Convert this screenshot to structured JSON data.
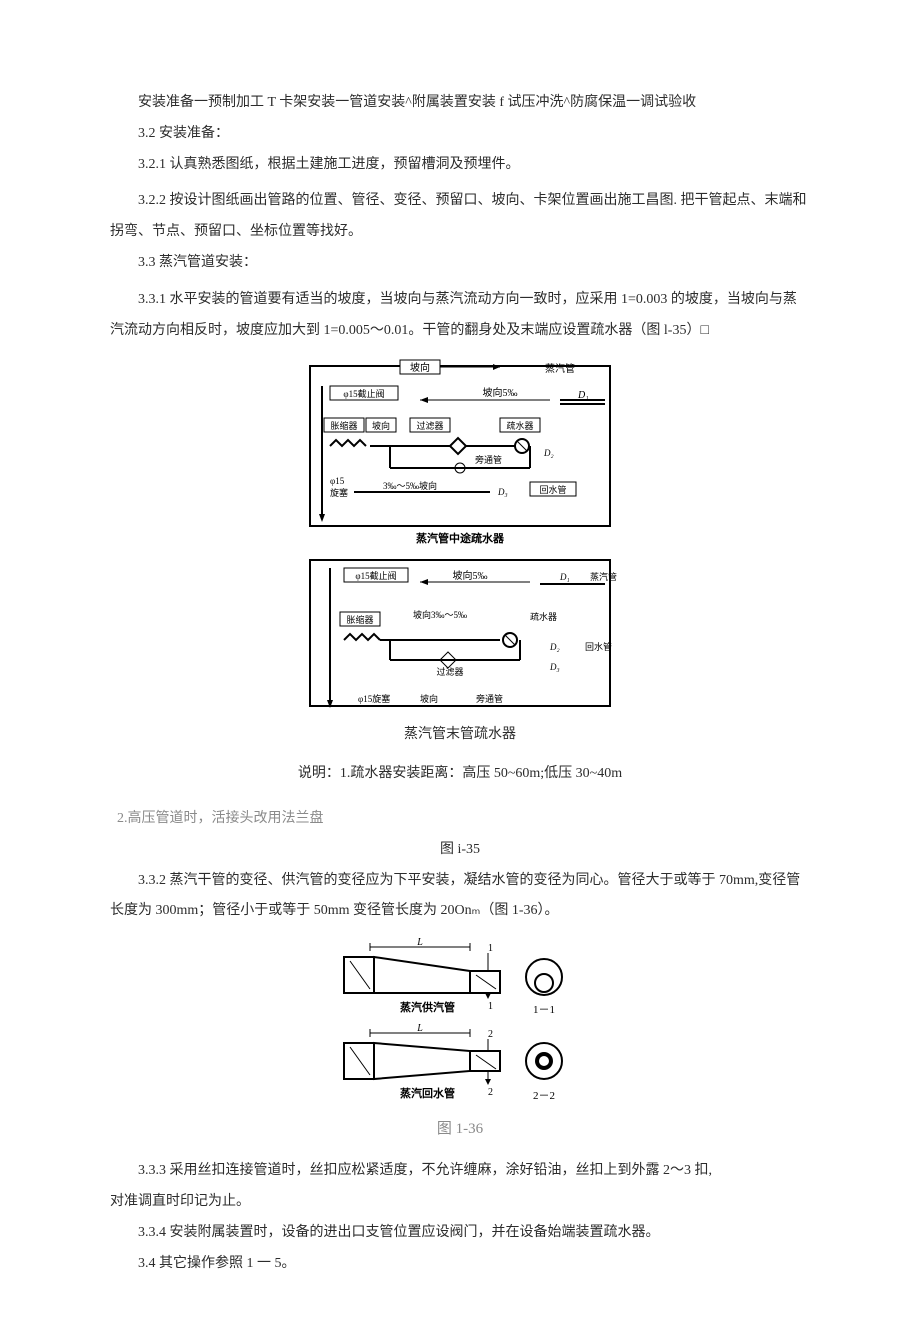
{
  "p1": "安装准备一预制加工 T 卡架安装一管道安装^附属装置安装 f 试压冲洗^防腐保温一调试验收",
  "p2": "3.2 安装准备：",
  "p3": "3.2.1 认真熟悉图纸，根据土建施工进度，预留槽洞及预埋件。",
  "p4": "3.2.2 按设计图纸画出管路的位置、管径、变径、预留口、坡向、卡架位置画出施工昌图. 把干管起点、末端和拐弯、节点、预留口、坐标位置等找好。",
  "p5": "3.3 蒸汽管道安装：",
  "p6": "3.3.1 水平安装的管道要有适当的坡度，当坡向与蒸汽流动方向一致时，应采用 1=0.003 的坡度，当坡向与蒸汽流动方向相反时，坡度应加大到 1=0.005～0.01。干管的翻身处及末端应设置疏水器（图 l-35）□",
  "fig135": {
    "top_labels": {
      "pohui": "坡向",
      "steam": "蒸汽管"
    },
    "upper": {
      "valve": "φ15截止阀",
      "slope": "坡向5‰",
      "d1": "D₁",
      "expander": "胀缩器",
      "pohui2": "坡向",
      "filter": "过滤器",
      "trap": "疏水器",
      "bypass": "旁通管",
      "d2": "D₂",
      "phi15": "φ15",
      "plug": "旋塞",
      "bottom_slope": "3‰～5‰坡向",
      "d3": "D₃",
      "return": "回水管"
    },
    "mid_caption": "蒸汽管中途疏水器",
    "lower": {
      "valve": "φ15截止阀",
      "slope": "坡向5‰",
      "d1": "D₁",
      "steam": "蒸汽管",
      "expander": "胀缩器",
      "slope2": "坡向3‰～5‰",
      "trap": "疏水器",
      "filter": "过滤器",
      "d2": "D₂",
      "return": "回水管",
      "phi15plug": "φ15旋塞",
      "pohui": "坡向",
      "bypass": "旁通管",
      "d3": "D₃"
    },
    "caption1": "蒸汽管末管疏水器",
    "caption2": "说明：1.疏水器安装距离：高压 50~60m;低压 30~40m",
    "caption3": "2.高压管道时，活接头改用法兰盘",
    "caption4": "图 i-35"
  },
  "p7": "3.3.2 蒸汽干管的变径、供汽管的变径应为下平安装，凝结水管的变径为同心。管径大于或等于 70mm,变径管长度为 300mm；管径小于或等于 50mm 变径管长度为 20Onₘ（图 1-36）。",
  "fig136": {
    "L1": "L",
    "one1": "1",
    "one2": "1",
    "lab1": "蒸汽供汽管",
    "sec1": "1－1",
    "L2": "L",
    "two1": "2",
    "two2": "2",
    "lab2": "蒸汽回水管",
    "sec2": "2－2",
    "caption": "图 1-36"
  },
  "p8": "3.3.3 采用丝扣连接管道时，丝扣应松紧适度，不允许缠麻，涂好铅油，丝扣上到外露 2～3 扣,",
  "p9": "对准调直时印记为止。",
  "p10": "3.3.4 安装附属装置时，设备的进出口支管位置应设阀门，并在设备始端装置疏水器。",
  "p11": "3.4 其它操作参照 1 一 5。"
}
